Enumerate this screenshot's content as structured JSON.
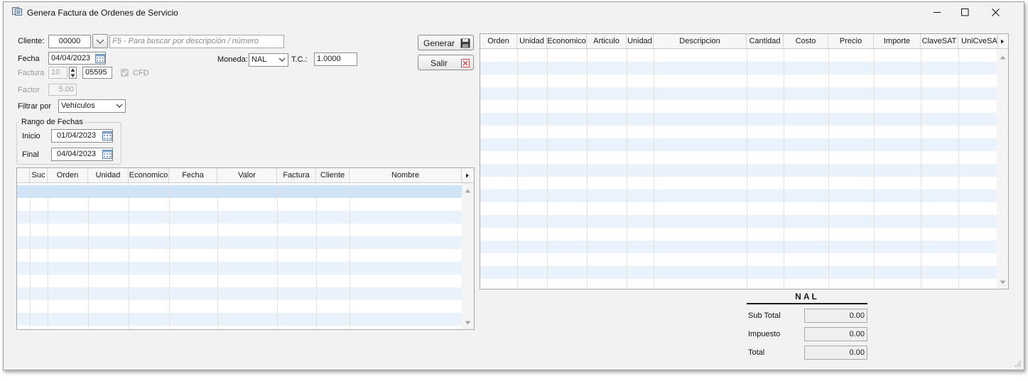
{
  "window": {
    "title": "Genera Factura de Ordenes de Servicio"
  },
  "form": {
    "cliente_label": "Cliente:",
    "cliente_value": "00000",
    "cliente_search_placeholder": "F5 - Para buscar por descripción / número",
    "fecha_label": "Fecha",
    "fecha_value": "04/04/2023",
    "moneda_label": "Moneda:",
    "moneda_value": "NAL",
    "tc_label": "T.C.:",
    "tc_value": "1.0000",
    "factura_label": "Factura",
    "factura_serie": "10",
    "factura_numero": "05595",
    "cfd_label": "CFD",
    "factor_label": "Factor",
    "factor_value": "5.00",
    "filtrar_label": "Filtrar por",
    "filtrar_value": "Vehículos",
    "rango_label": "Rango de Fechas",
    "inicio_label": "Inicio",
    "inicio_value": "01/04/2023",
    "final_label": "Final",
    "final_value": "04/04/2023"
  },
  "buttons": {
    "generar": "Generar",
    "salir": "Salir"
  },
  "orders_grid": {
    "columns": [
      "Suc",
      "Orden",
      "Unidad",
      "Economico",
      "Fecha",
      "Valor",
      "Factura",
      "Cliente",
      "Nombre"
    ]
  },
  "detail_grid": {
    "columns": [
      "Orden",
      "Unidad",
      "Economico",
      "Articulo",
      "Unidad",
      "Descripcion",
      "Cantidad",
      "Costo",
      "Precio",
      "Importe",
      "ClaveSAT",
      "UniCveSAT"
    ]
  },
  "totals": {
    "currency": "NAL",
    "subtotal_label": "Sub Total",
    "subtotal_value": "0.00",
    "impuesto_label": "Impuesto",
    "impuesto_value": "0.00",
    "total_label": "Total",
    "total_value": "0.00"
  }
}
